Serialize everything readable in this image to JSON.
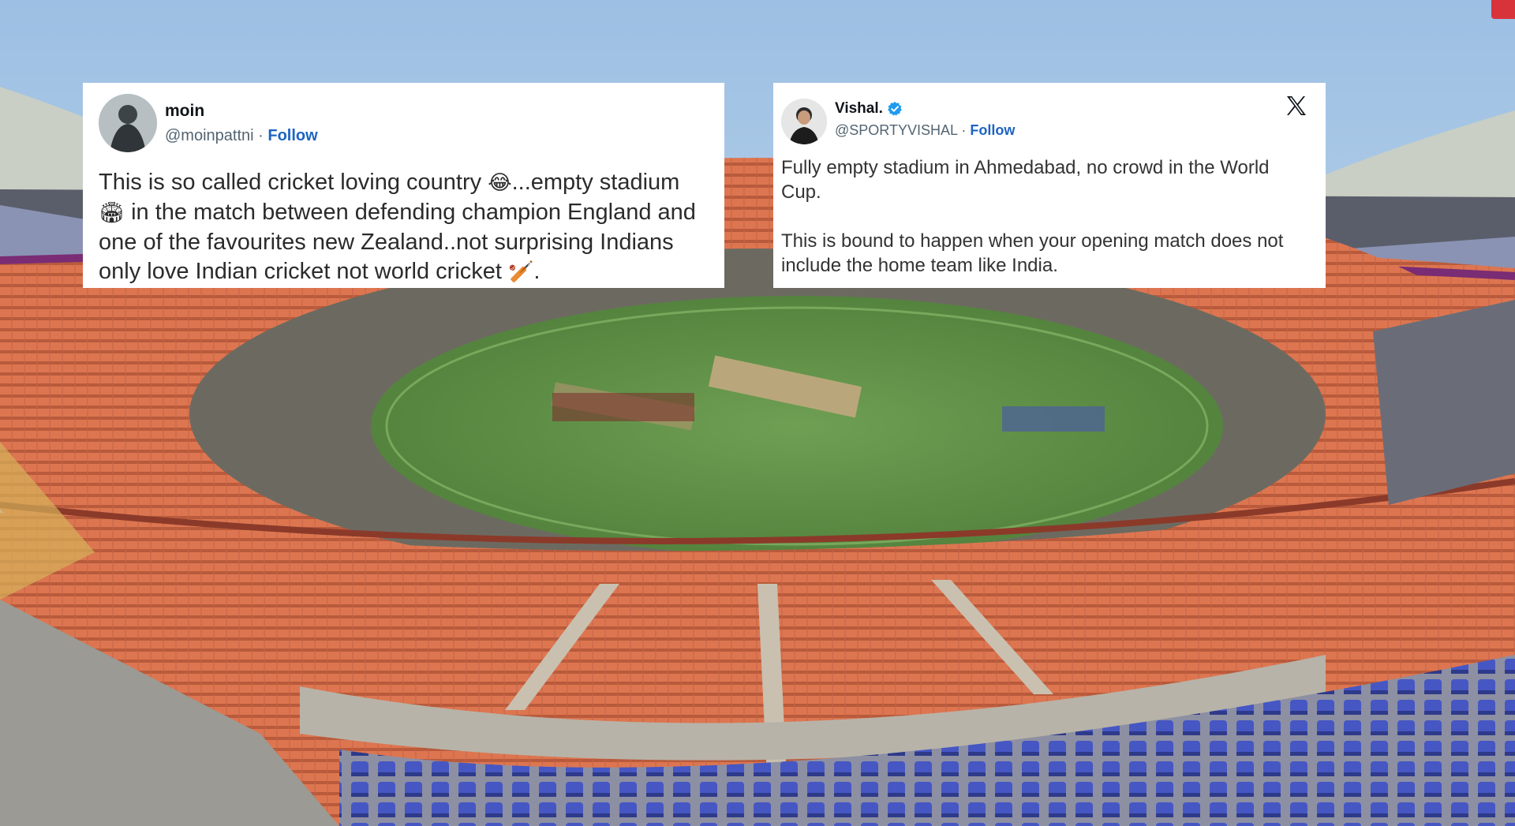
{
  "tweets": [
    {
      "display_name": "moin",
      "handle": "@moinpattni",
      "separator": "·",
      "follow_label": "Follow",
      "text_part1": "This is so called cricket loving country ",
      "emoji1": "😂",
      "text_part2": "...empty stadium ",
      "emoji2": "🏟",
      "text_part3": " in the match between defending champion England and one of the favourites new Zealand..not surprising Indians only love Indian cricket not world cricket ",
      "emoji3": "🏏",
      "text_part4": "."
    },
    {
      "display_name": "Vishal.",
      "handle": "@SPORTYVISHAL",
      "separator": "·",
      "follow_label": "Follow",
      "paragraph1": "Fully empty stadium in Ahmedabad, no crowd in the World Cup.",
      "paragraph2": "This is bound to happen when your opening match does not include the home team like India.",
      "icons": {
        "verified": "verified-badge-icon",
        "platform": "x-logo-icon"
      }
    }
  ],
  "colors": {
    "sky": "#a9c8e6",
    "pitch": "#5d8f45",
    "seats": "#d8704a",
    "follow": "#1d64c2",
    "verified": "#1d9bf0"
  }
}
